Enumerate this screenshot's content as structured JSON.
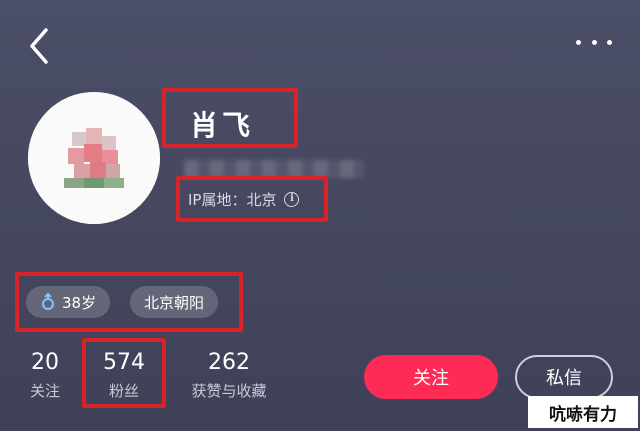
{
  "header": {
    "back_icon": "chevron-left-icon",
    "more_icon": "more-dots-icon"
  },
  "profile": {
    "name": "肖飞",
    "ip_location": "IP属地：北京",
    "info_icon_glyph": "i",
    "tags": [
      {
        "icon": "female-gender-icon",
        "label": "38岁"
      },
      {
        "label": "北京朝阳"
      }
    ]
  },
  "stats": [
    {
      "value": "20",
      "label": "关注"
    },
    {
      "value": "574",
      "label": "粉丝"
    },
    {
      "value": "262",
      "label": "获赞与收藏"
    }
  ],
  "actions": {
    "follow_label": "关注",
    "message_label": "私信"
  },
  "watermark": "吭哧有力",
  "colors": {
    "accent": "#fe2c55",
    "highlight_box": "#d8232a",
    "background": "#45485f"
  }
}
